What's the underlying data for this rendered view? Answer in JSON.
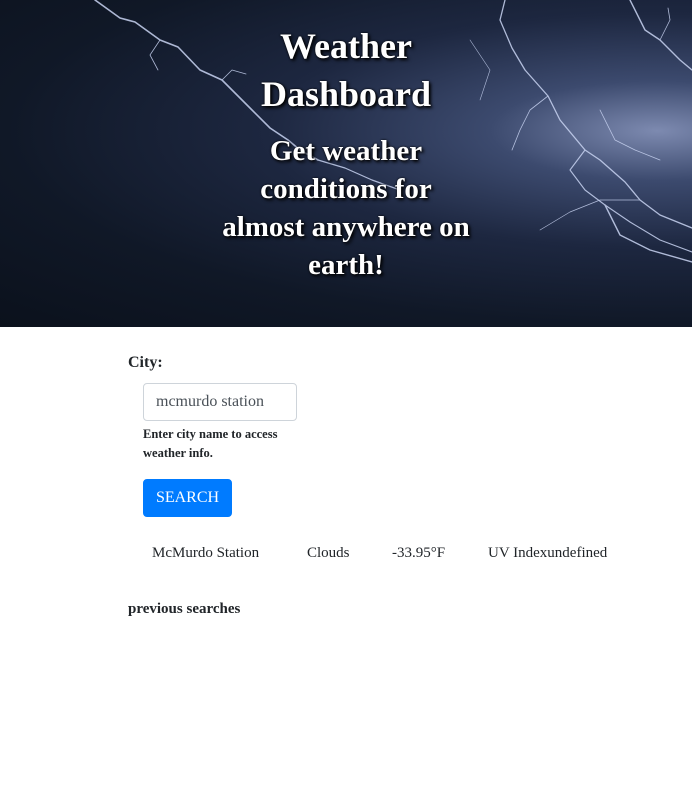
{
  "hero": {
    "title": "Weather Dashboard",
    "subtitle": "Get weather conditions for almost anywhere on earth!"
  },
  "form": {
    "city_label": "City:",
    "city_input_value": "mcmurdo station",
    "helper_text": "Enter city name to access weather info.",
    "search_label": "SEARCH",
    "search_color": "#007bff"
  },
  "result": {
    "city": "McMurdo Station",
    "condition": "Clouds",
    "temperature": "-33.95°F",
    "uv": "UV Indexundefined"
  },
  "previous": {
    "heading": "previous searches",
    "items": []
  }
}
